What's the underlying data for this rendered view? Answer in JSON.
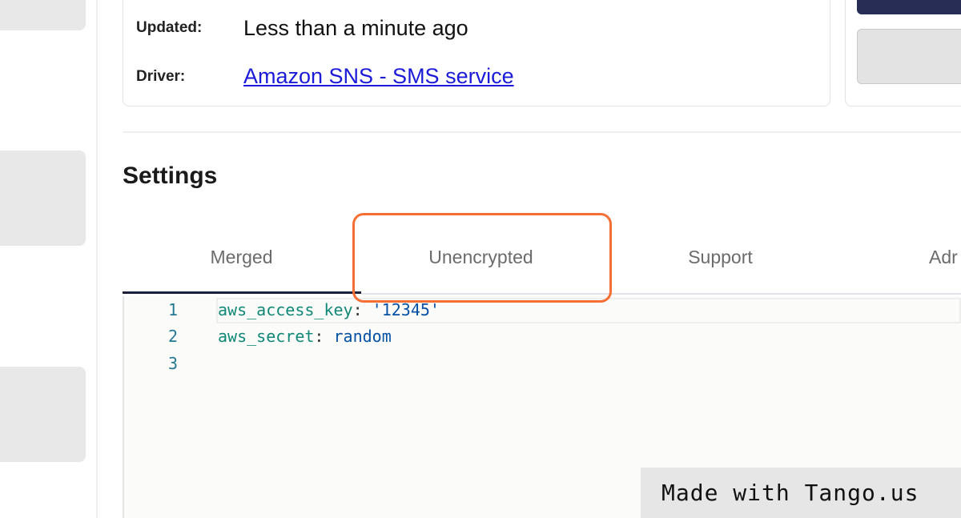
{
  "details": {
    "updated_label": "Updated:",
    "updated_value": "Less than a minute ago",
    "driver_label": "Driver:",
    "driver_value": "Amazon SNS - SMS service"
  },
  "settings": {
    "title": "Settings",
    "tabs": [
      {
        "label": "Merged",
        "active": true
      },
      {
        "label": "Unencrypted",
        "highlighted": true
      },
      {
        "label": "Support"
      },
      {
        "label": "Adr"
      }
    ]
  },
  "editor": {
    "line_numbers": [
      "1",
      "2",
      "3"
    ],
    "lines": [
      {
        "key": "aws_access_key",
        "sep": ": ",
        "value": "'12345'"
      },
      {
        "key": "aws_secret",
        "sep": ": ",
        "value": "random"
      }
    ]
  },
  "watermark": "Made with Tango.us",
  "colors": {
    "highlight": "#f56e33",
    "active_tab": "#1a1f3c",
    "link": "#1a1ad8"
  }
}
